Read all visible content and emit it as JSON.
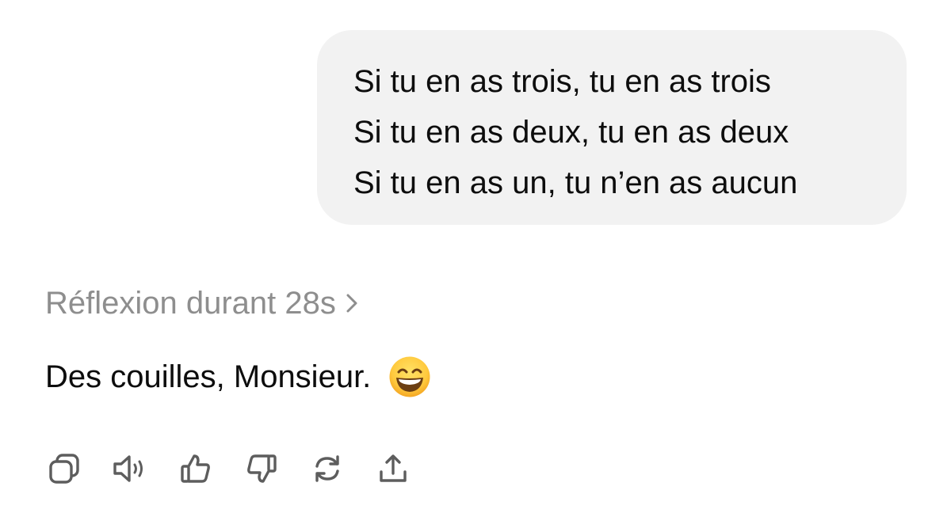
{
  "user_message": {
    "lines": [
      "Si tu en as trois, tu en as trois",
      "Si tu en as deux, tu en as deux",
      "Si tu en as un, tu n’en as aucun"
    ]
  },
  "reasoning": {
    "label": "Réflexion durant 28s",
    "icon": "chevron-right-icon"
  },
  "assistant_message": {
    "text": "Des couilles, Monsieur.",
    "emoji": "grinning-face-with-smiling-eyes"
  },
  "actions": [
    {
      "name": "copy",
      "icon": "copy-icon"
    },
    {
      "name": "read-aloud",
      "icon": "speaker-icon"
    },
    {
      "name": "good-response",
      "icon": "thumbs-up-icon"
    },
    {
      "name": "bad-response",
      "icon": "thumbs-down-icon"
    },
    {
      "name": "regenerate",
      "icon": "refresh-icon"
    },
    {
      "name": "share",
      "icon": "share-icon"
    }
  ],
  "colors": {
    "bubble_background": "#f2f2f2",
    "text": "#0d0d0d",
    "muted_text": "#8e8e8e",
    "icon": "#5d5d5d"
  }
}
